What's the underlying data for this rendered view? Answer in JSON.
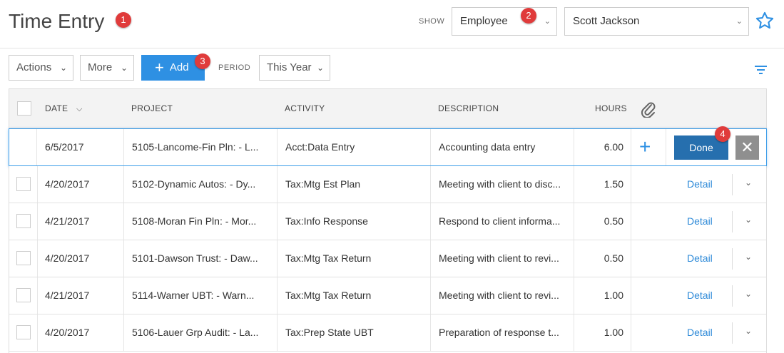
{
  "header": {
    "title": "Time Entry",
    "show_label": "SHOW",
    "show_select": "Employee",
    "employee_select": "Scott Jackson"
  },
  "badges": [
    "1",
    "2",
    "3",
    "4"
  ],
  "toolbar": {
    "actions_label": "Actions",
    "more_label": "More",
    "add_label": "Add",
    "period_label": "PERIOD",
    "period_value": "This Year"
  },
  "table": {
    "columns": {
      "date": "DATE",
      "project": "PROJECT",
      "activity": "ACTIVITY",
      "description": "DESCRIPTION",
      "hours": "HOURS"
    },
    "edit_row": {
      "date": "6/5/2017",
      "project": "5105-Lancome-Fin Pln: - L...",
      "activity": "Acct:Data Entry",
      "description": "Accounting data entry",
      "hours": "6.00",
      "done_label": "Done",
      "close_glyph": "✕",
      "add_glyph": "+"
    },
    "detail_label": "Detail",
    "rows": [
      {
        "date": "4/20/2017",
        "project": "5102-Dynamic Autos: - Dy...",
        "activity": "Tax:Mtg Est Plan",
        "description": "Meeting with client to disc...",
        "hours": "1.50"
      },
      {
        "date": "4/21/2017",
        "project": "5108-Moran Fin Pln: - Mor...",
        "activity": "Tax:Info Response",
        "description": "Respond to client informa...",
        "hours": "0.50"
      },
      {
        "date": "4/20/2017",
        "project": "5101-Dawson Trust: - Daw...",
        "activity": "Tax:Mtg Tax Return",
        "description": "Meeting with client to revi...",
        "hours": "0.50"
      },
      {
        "date": "4/21/2017",
        "project": "5114-Warner UBT: - Warn...",
        "activity": "Tax:Mtg Tax Return",
        "description": "Meeting with client to revi...",
        "hours": "1.00"
      },
      {
        "date": "4/20/2017",
        "project": "5106-Lauer Grp Audit: - La...",
        "activity": "Tax:Prep State UBT",
        "description": "Preparation of response t...",
        "hours": "1.00"
      }
    ]
  },
  "icons": {
    "star": "star-icon",
    "filter": "filter-icon",
    "attachment": "paperclip-icon",
    "chevron": "chevron-down-icon"
  },
  "colors": {
    "accent": "#2e90e3",
    "done": "#266fae",
    "badge": "#e03b3b",
    "link": "#2e8ad8"
  }
}
